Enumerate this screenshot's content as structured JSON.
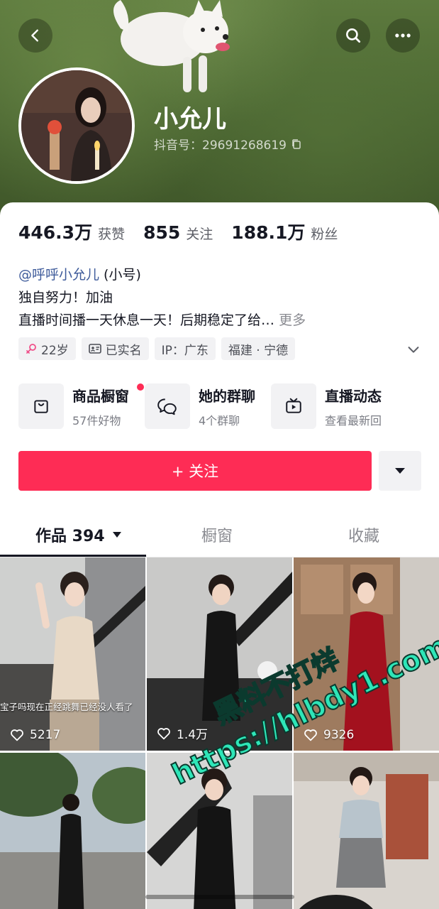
{
  "header": {
    "back_icon": "chevron-left-icon",
    "search_icon": "search-icon",
    "more_icon": "more-dots-icon",
    "nickname": "小允儿",
    "douyin_id": "抖音号：29691268619",
    "copy_icon": "copy-icon"
  },
  "stats": [
    {
      "num": "446.3万",
      "label": "获赞"
    },
    {
      "num": "855",
      "label": "关注"
    },
    {
      "num": "188.1万",
      "label": "粉丝"
    }
  ],
  "bio": {
    "mention": "@呼呼小允儿",
    "mention_suffix": " (小号)",
    "line2": "独自努力！加油",
    "line3": "直播时间播一天休息一天！后期稳定了给…",
    "more": "更多"
  },
  "tags": [
    {
      "icon": "female-icon",
      "text": "22岁"
    },
    {
      "icon": "id-card-icon",
      "text": "已实名"
    },
    {
      "icon": "",
      "text": "IP：广东"
    },
    {
      "icon": "",
      "text": "福建 · 宁德"
    }
  ],
  "features": [
    {
      "icon": "shopping-bag-icon",
      "title": "商品橱窗",
      "sub": "57件好物"
    },
    {
      "icon": "group-chat-icon",
      "title": "她的群聊",
      "sub": "4个群聊"
    },
    {
      "icon": "tv-live-icon",
      "title": "直播动态",
      "sub": "查看最新回"
    }
  ],
  "follow_button": "+ 关注",
  "tabs": {
    "works": "作品 394",
    "showcase": "橱窗",
    "favorites": "收藏"
  },
  "videos": [
    {
      "likes": "5217",
      "caption": "宝子吗现在正经跳舞已经没人看了"
    },
    {
      "likes": "1.4万",
      "caption": ""
    },
    {
      "likes": "9326",
      "caption": ""
    },
    {
      "likes": "",
      "caption": ""
    },
    {
      "likes": "",
      "caption": ""
    },
    {
      "likes": "",
      "caption": ""
    }
  ],
  "watermark": {
    "line1": "黑料不打烊",
    "line2": "https://hlbdy1.com"
  },
  "colors": {
    "accent": "#fe2c55",
    "mention": "#3d5a9a",
    "watermark": "#2ee6b8"
  }
}
